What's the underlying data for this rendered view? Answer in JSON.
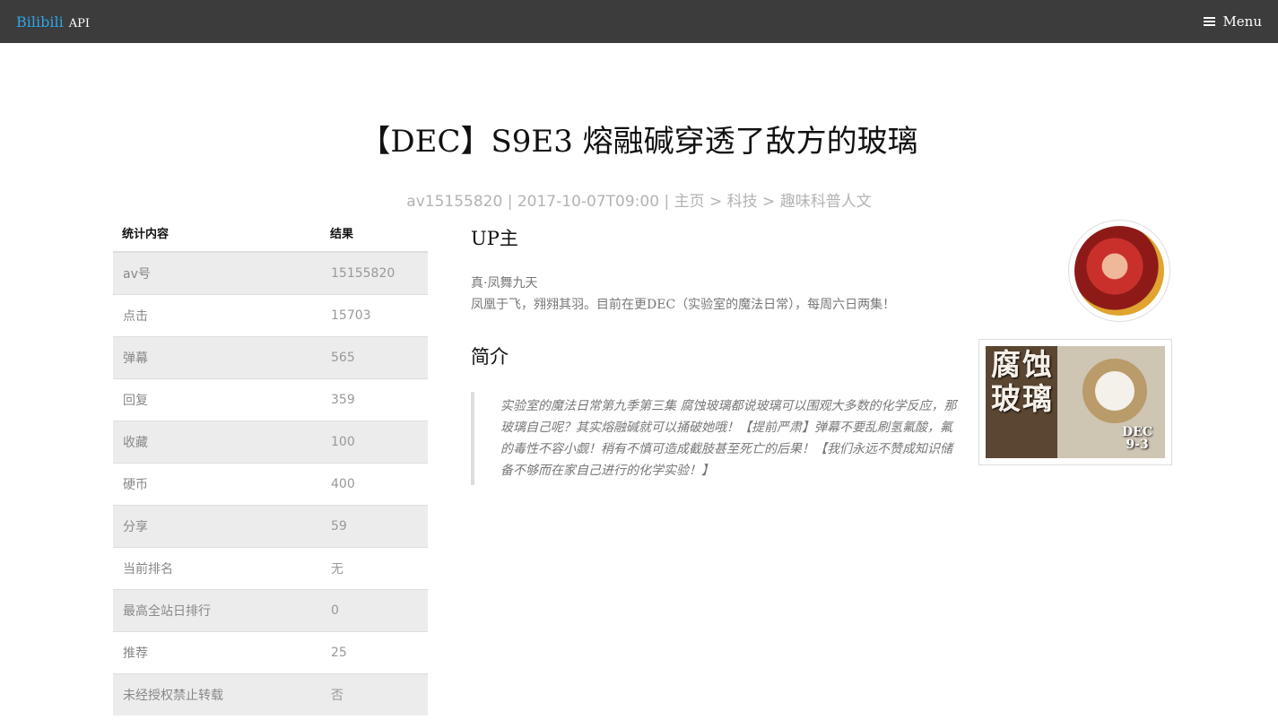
{
  "topbar": {
    "brand": "Bilibili",
    "brand_sub": "API",
    "menu_label": "Menu",
    "menu_icon": "hamburger-icon"
  },
  "video": {
    "title": "【DEC】S9E3 熔融碱穿透了敌方的玻璃",
    "meta": {
      "av": "av15155820",
      "sep1": "|",
      "datetime": "2017-10-07T09:00",
      "sep2": "|",
      "home": "主页",
      "arrow1": ">",
      "category": "科技",
      "arrow2": ">",
      "subcategory": "趣味科普人文"
    }
  },
  "stats": {
    "header_item": "统计内容",
    "header_result": "结果",
    "rows": [
      {
        "label": "av号",
        "value": "15155820"
      },
      {
        "label": "点击",
        "value": "15703"
      },
      {
        "label": "弹幕",
        "value": "565"
      },
      {
        "label": "回复",
        "value": "359"
      },
      {
        "label": "收藏",
        "value": "100"
      },
      {
        "label": "硬币",
        "value": "400"
      },
      {
        "label": "分享",
        "value": "59"
      },
      {
        "label": "当前排名",
        "value": "无"
      },
      {
        "label": "最高全站日排行",
        "value": "0"
      },
      {
        "label": "推荐",
        "value": "25"
      },
      {
        "label": "未经授权禁止转载",
        "value": "否"
      }
    ]
  },
  "up": {
    "heading": "UP主",
    "name": "真·凤舞九天",
    "description": "凤凰于飞，翙翙其羽。目前在更DEC（实验室的魔法日常），每周六日两集！"
  },
  "intro": {
    "heading": "简介",
    "text": "实验室的魔法日常第九季第三集 腐蚀玻璃都说玻璃可以围观大多数的化学反应，那玻璃自己呢？其实熔融碱就可以捅破她哦！【提前严肃】弹幕不要乱刷氢氟酸，氟的毒性不容小觑！稍有不慎可造成截肢甚至死亡的后果！【我们永远不赞成知识储备不够而在家自己进行的化学实验！】"
  },
  "cover": {
    "title_text": "腐蚀玻璃",
    "tag_line1": "DEC",
    "tag_line2": "9-3"
  }
}
